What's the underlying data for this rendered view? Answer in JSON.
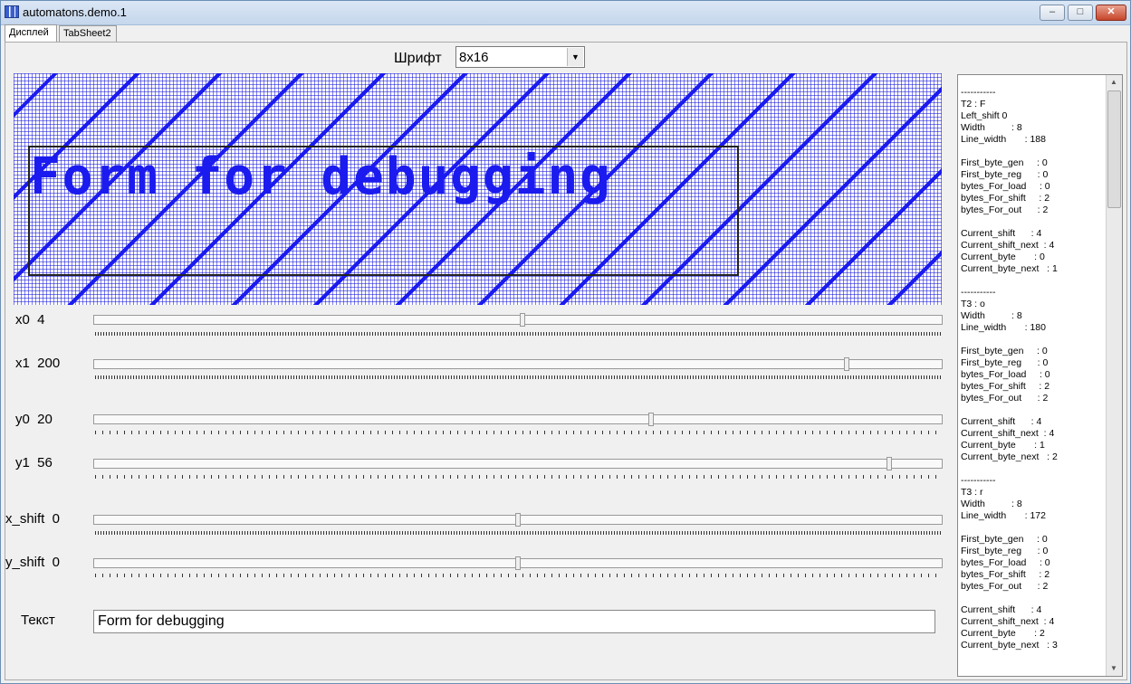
{
  "window": {
    "title": "automatons.demo.1",
    "min": "–",
    "max": "□",
    "close": "✕",
    "icon": "app-grid-icon"
  },
  "tabs": [
    {
      "label": "Дисплей"
    },
    {
      "label": "TabSheet2"
    }
  ],
  "font": {
    "label": "Шрифт",
    "value": "8x16"
  },
  "display": {
    "text": "Form for debugging",
    "pixel_color": "#1b1bef"
  },
  "sliders": [
    {
      "label": "x0  4",
      "position": 0.505
    },
    {
      "label": "x1  200",
      "position": 0.887
    },
    {
      "label": "y0  20",
      "position": 0.657
    },
    {
      "label": "y1  56",
      "position": 0.937
    },
    {
      "label": "x_shift  0",
      "position": 0.5
    },
    {
      "label": "y_shift  0",
      "position": 0.5
    }
  ],
  "text_field": {
    "label": "Текст",
    "value": "Form for debugging"
  },
  "debug_log": [
    "-----------",
    "T2 : F",
    "Left_shift 0",
    "Width          : 8",
    "Line_width       : 188",
    "",
    "First_byte_gen     : 0",
    "First_byte_reg      : 0",
    "bytes_For_load     : 0",
    "bytes_For_shift     : 2",
    "bytes_For_out      : 2",
    "",
    "Current_shift      : 4",
    "Current_shift_next  : 4",
    "Current_byte       : 0",
    "Current_byte_next   : 1",
    "",
    "-----------",
    "T3 : o",
    "Width          : 8",
    "Line_width       : 180",
    "",
    "First_byte_gen     : 0",
    "First_byte_reg      : 0",
    "bytes_For_load     : 0",
    "bytes_For_shift     : 2",
    "bytes_For_out      : 2",
    "",
    "Current_shift      : 4",
    "Current_shift_next  : 4",
    "Current_byte       : 1",
    "Current_byte_next   : 2",
    "",
    "-----------",
    "T3 : r",
    "Width          : 8",
    "Line_width       : 172",
    "",
    "First_byte_gen     : 0",
    "First_byte_reg      : 0",
    "bytes_For_load     : 0",
    "bytes_For_shift     : 2",
    "bytes_For_out      : 2",
    "",
    "Current_shift      : 4",
    "Current_shift_next  : 4",
    "Current_byte       : 2",
    "Current_byte_next   : 3"
  ]
}
